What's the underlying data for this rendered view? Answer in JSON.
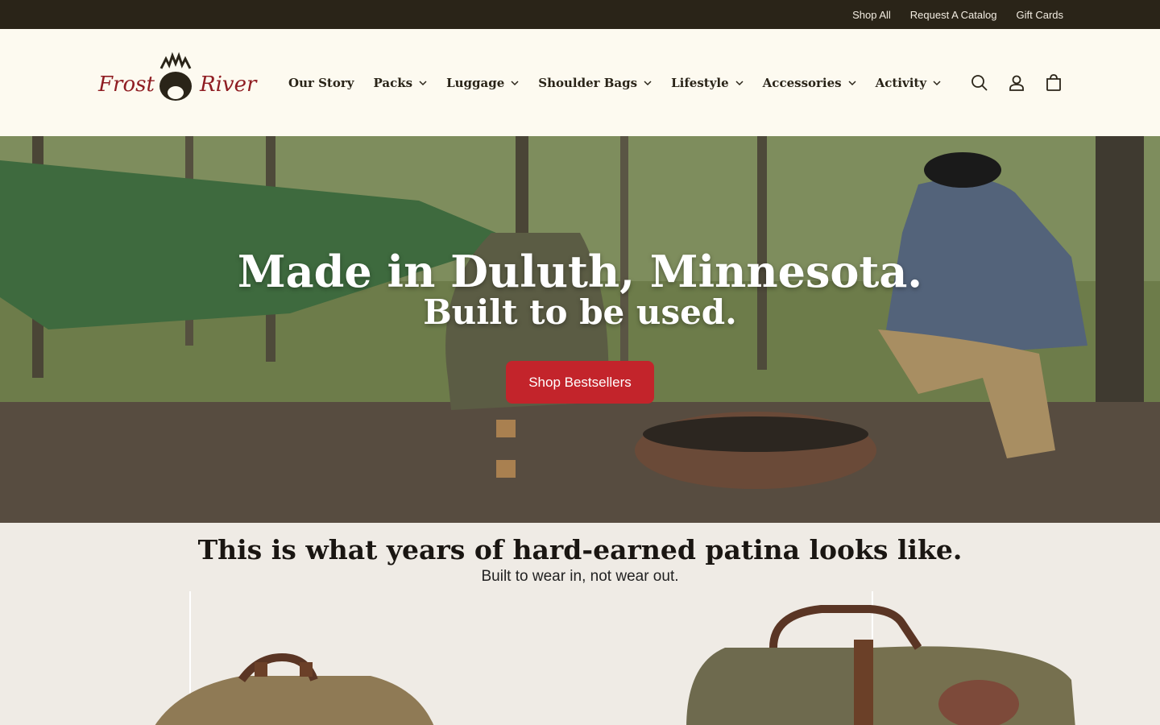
{
  "topbar": {
    "links": [
      "Shop All",
      "Request A Catalog",
      "Gift Cards"
    ]
  },
  "header": {
    "logo_text": "Frost River",
    "nav": [
      {
        "label": "Our Story",
        "dropdown": false
      },
      {
        "label": "Packs",
        "dropdown": true
      },
      {
        "label": "Luggage",
        "dropdown": true
      },
      {
        "label": "Shoulder Bags",
        "dropdown": true
      },
      {
        "label": "Lifestyle",
        "dropdown": true
      },
      {
        "label": "Accessories",
        "dropdown": true
      },
      {
        "label": "Activity",
        "dropdown": true
      }
    ],
    "icons": [
      "search-icon",
      "account-icon",
      "cart-icon"
    ]
  },
  "hero": {
    "heading": "Made in Duluth, Minnesota.",
    "subheading": "Built to be used.",
    "button": "Shop Bestsellers"
  },
  "section": {
    "title": "This is what years of hard-earned patina looks like.",
    "subtitle": "Built to wear in, not wear out."
  },
  "colors": {
    "topbar_bg": "#2a2418",
    "header_bg": "#fdfaf0",
    "accent": "#c3242b",
    "section_bg": "#efebe5"
  }
}
